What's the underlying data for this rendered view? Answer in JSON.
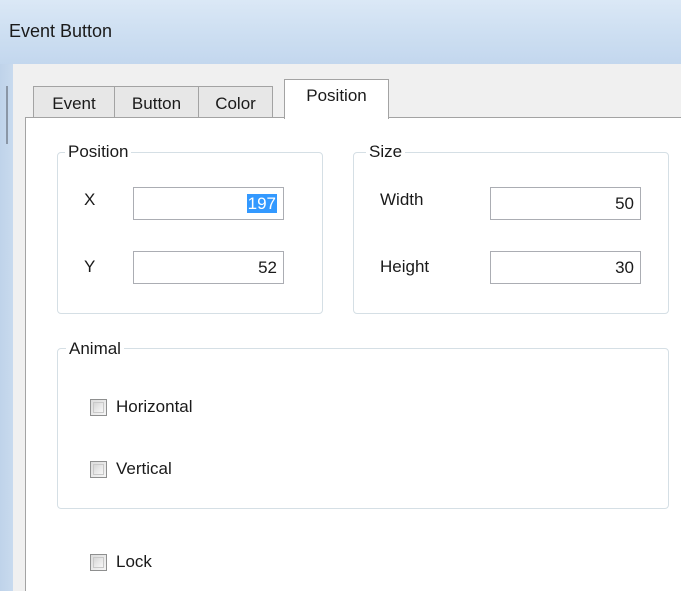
{
  "window": {
    "title": "Event Button"
  },
  "tabs": [
    {
      "label": "Event",
      "active": false
    },
    {
      "label": "Button",
      "active": false
    },
    {
      "label": "Color",
      "active": false
    },
    {
      "label": "Position",
      "active": true
    }
  ],
  "position_group": {
    "legend": "Position",
    "x_label": "X",
    "x_value_selected": "197",
    "y_label": "Y",
    "y_value": "52"
  },
  "size_group": {
    "legend": "Size",
    "width_label": "Width",
    "width_value": "50",
    "height_label": "Height",
    "height_value": "30"
  },
  "animal_group": {
    "legend": "Animal",
    "horizontal_label": "Horizontal",
    "horizontal_checked": false,
    "vertical_label": "Vertical",
    "vertical_checked": false
  },
  "lock": {
    "label": "Lock",
    "checked": false
  },
  "colors": {
    "selection": "#3399ff",
    "titlebar": "#cfe0f2",
    "dialog_face": "#f0f0f0"
  }
}
